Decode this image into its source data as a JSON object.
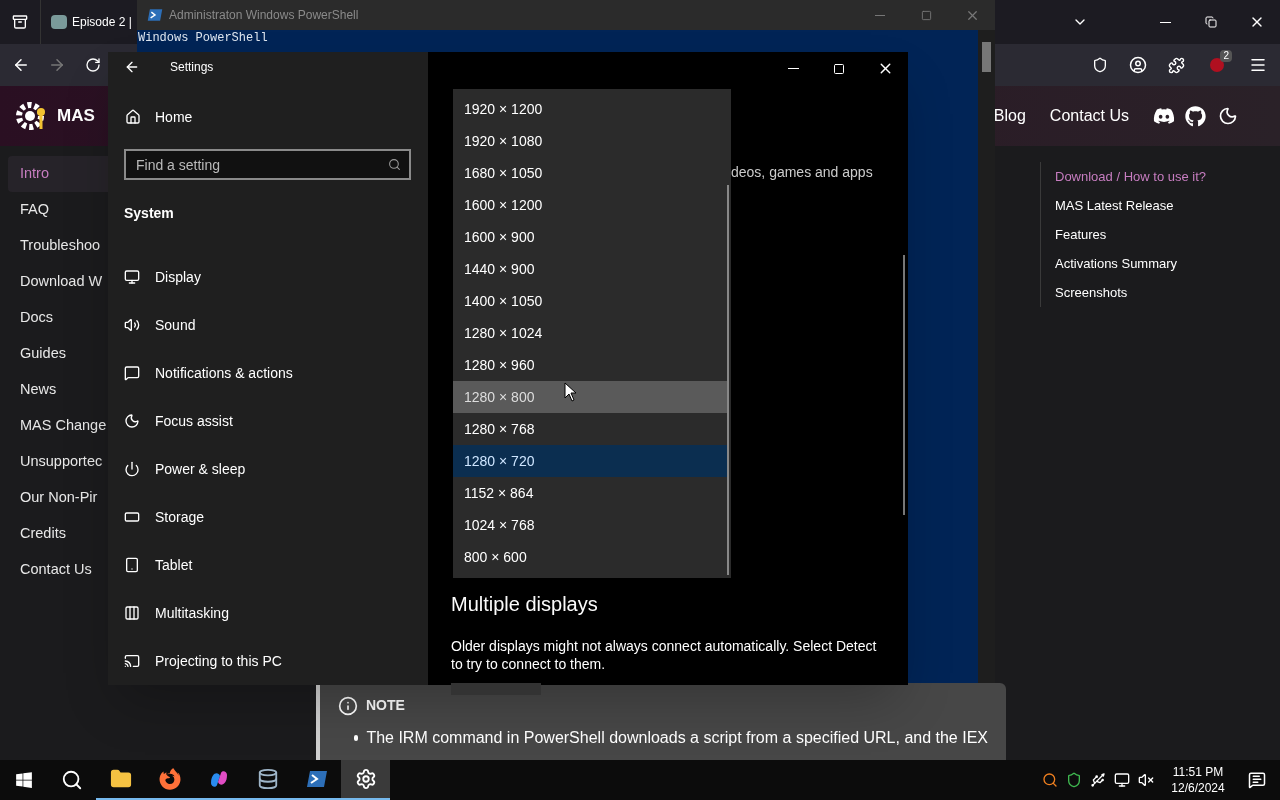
{
  "browser": {
    "tab_title": "Episode 2 |",
    "extension_badge": "2",
    "site_name": "MAS",
    "nav_links": [
      "Blog",
      "Contact Us"
    ],
    "sidebar": [
      {
        "label": "Intro",
        "selected": true
      },
      {
        "label": "FAQ",
        "selected": false
      },
      {
        "label": "Troubleshoo",
        "selected": false
      },
      {
        "label": "Download W",
        "selected": false
      },
      {
        "label": "Docs",
        "selected": false
      },
      {
        "label": "Guides",
        "selected": false
      },
      {
        "label": "News",
        "selected": false
      },
      {
        "label": "MAS Change",
        "selected": false
      },
      {
        "label": "Unsupportec",
        "selected": false
      },
      {
        "label": "Our Non-Pir",
        "selected": false
      },
      {
        "label": "Credits",
        "selected": false
      },
      {
        "label": "Contact Us",
        "selected": false
      }
    ],
    "toc": [
      {
        "label": "Download / How to use it?",
        "selected": true
      },
      {
        "label": "MAS Latest Release",
        "selected": false
      },
      {
        "label": "Features",
        "selected": false
      },
      {
        "label": "Activations Summary",
        "selected": false
      },
      {
        "label": "Screenshots",
        "selected": false
      }
    ],
    "note": {
      "title": "NOTE",
      "bullets": [
        "The IRM command in PowerShell downloads a script from a specified URL, and the IEX"
      ]
    }
  },
  "powershell": {
    "title": "Administraton Windows PowerShell",
    "lines": [
      "Windows PowerShell"
    ]
  },
  "settings": {
    "title": "Settings",
    "home": "Home",
    "search": {
      "placeholder": "Find a setting"
    },
    "section": "System",
    "items": [
      {
        "label": "Display",
        "kind": "display"
      },
      {
        "label": "Sound",
        "kind": "sound"
      },
      {
        "label": "Notifications & actions",
        "kind": "notifications"
      },
      {
        "label": "Focus assist",
        "kind": "focus"
      },
      {
        "label": "Power & sleep",
        "kind": "power"
      },
      {
        "label": "Storage",
        "kind": "storage"
      },
      {
        "label": "Tablet",
        "kind": "tablet"
      },
      {
        "label": "Multitasking",
        "kind": "multitasking"
      },
      {
        "label": "Projecting to this PC",
        "kind": "projecting"
      }
    ],
    "partial_text": "deos, games and apps",
    "heading": "Multiple displays",
    "paragraph": "Older displays might not always connect automatically. Select Detect to try to connect to them.",
    "resolutions": [
      {
        "label": "1920 × 1200",
        "selected": false,
        "hovered": false
      },
      {
        "label": "1920 × 1080",
        "selected": false,
        "hovered": false
      },
      {
        "label": "1680 × 1050",
        "selected": false,
        "hovered": false
      },
      {
        "label": "1600 × 1200",
        "selected": false,
        "hovered": false
      },
      {
        "label": "1600 × 900",
        "selected": false,
        "hovered": false
      },
      {
        "label": "1440 × 900",
        "selected": false,
        "hovered": false
      },
      {
        "label": "1400 × 1050",
        "selected": false,
        "hovered": false
      },
      {
        "label": "1280 × 1024",
        "selected": false,
        "hovered": false
      },
      {
        "label": "1280 × 960",
        "selected": false,
        "hovered": false
      },
      {
        "label": "1280 × 800",
        "selected": false,
        "hovered": true
      },
      {
        "label": "1280 × 768",
        "selected": false,
        "hovered": false
      },
      {
        "label": "1280 × 720",
        "selected": true,
        "hovered": false
      },
      {
        "label": "1152 × 864",
        "selected": false,
        "hovered": false
      },
      {
        "label": "1024 × 768",
        "selected": false,
        "hovered": false
      },
      {
        "label": "800 × 600",
        "selected": false,
        "hovered": false
      }
    ]
  },
  "taskbar": {
    "apps": [
      {
        "kind": "explorer",
        "running": true,
        "selected": false
      },
      {
        "kind": "firefox",
        "running": true,
        "selected": false
      },
      {
        "kind": "copilot",
        "running": true,
        "selected": false
      },
      {
        "kind": "database",
        "running": true,
        "selected": false
      },
      {
        "kind": "powershell",
        "running": true,
        "selected": false
      },
      {
        "kind": "settings",
        "running": true,
        "selected": true
      }
    ],
    "time": "11:51 PM",
    "date": "12/6/2024"
  }
}
